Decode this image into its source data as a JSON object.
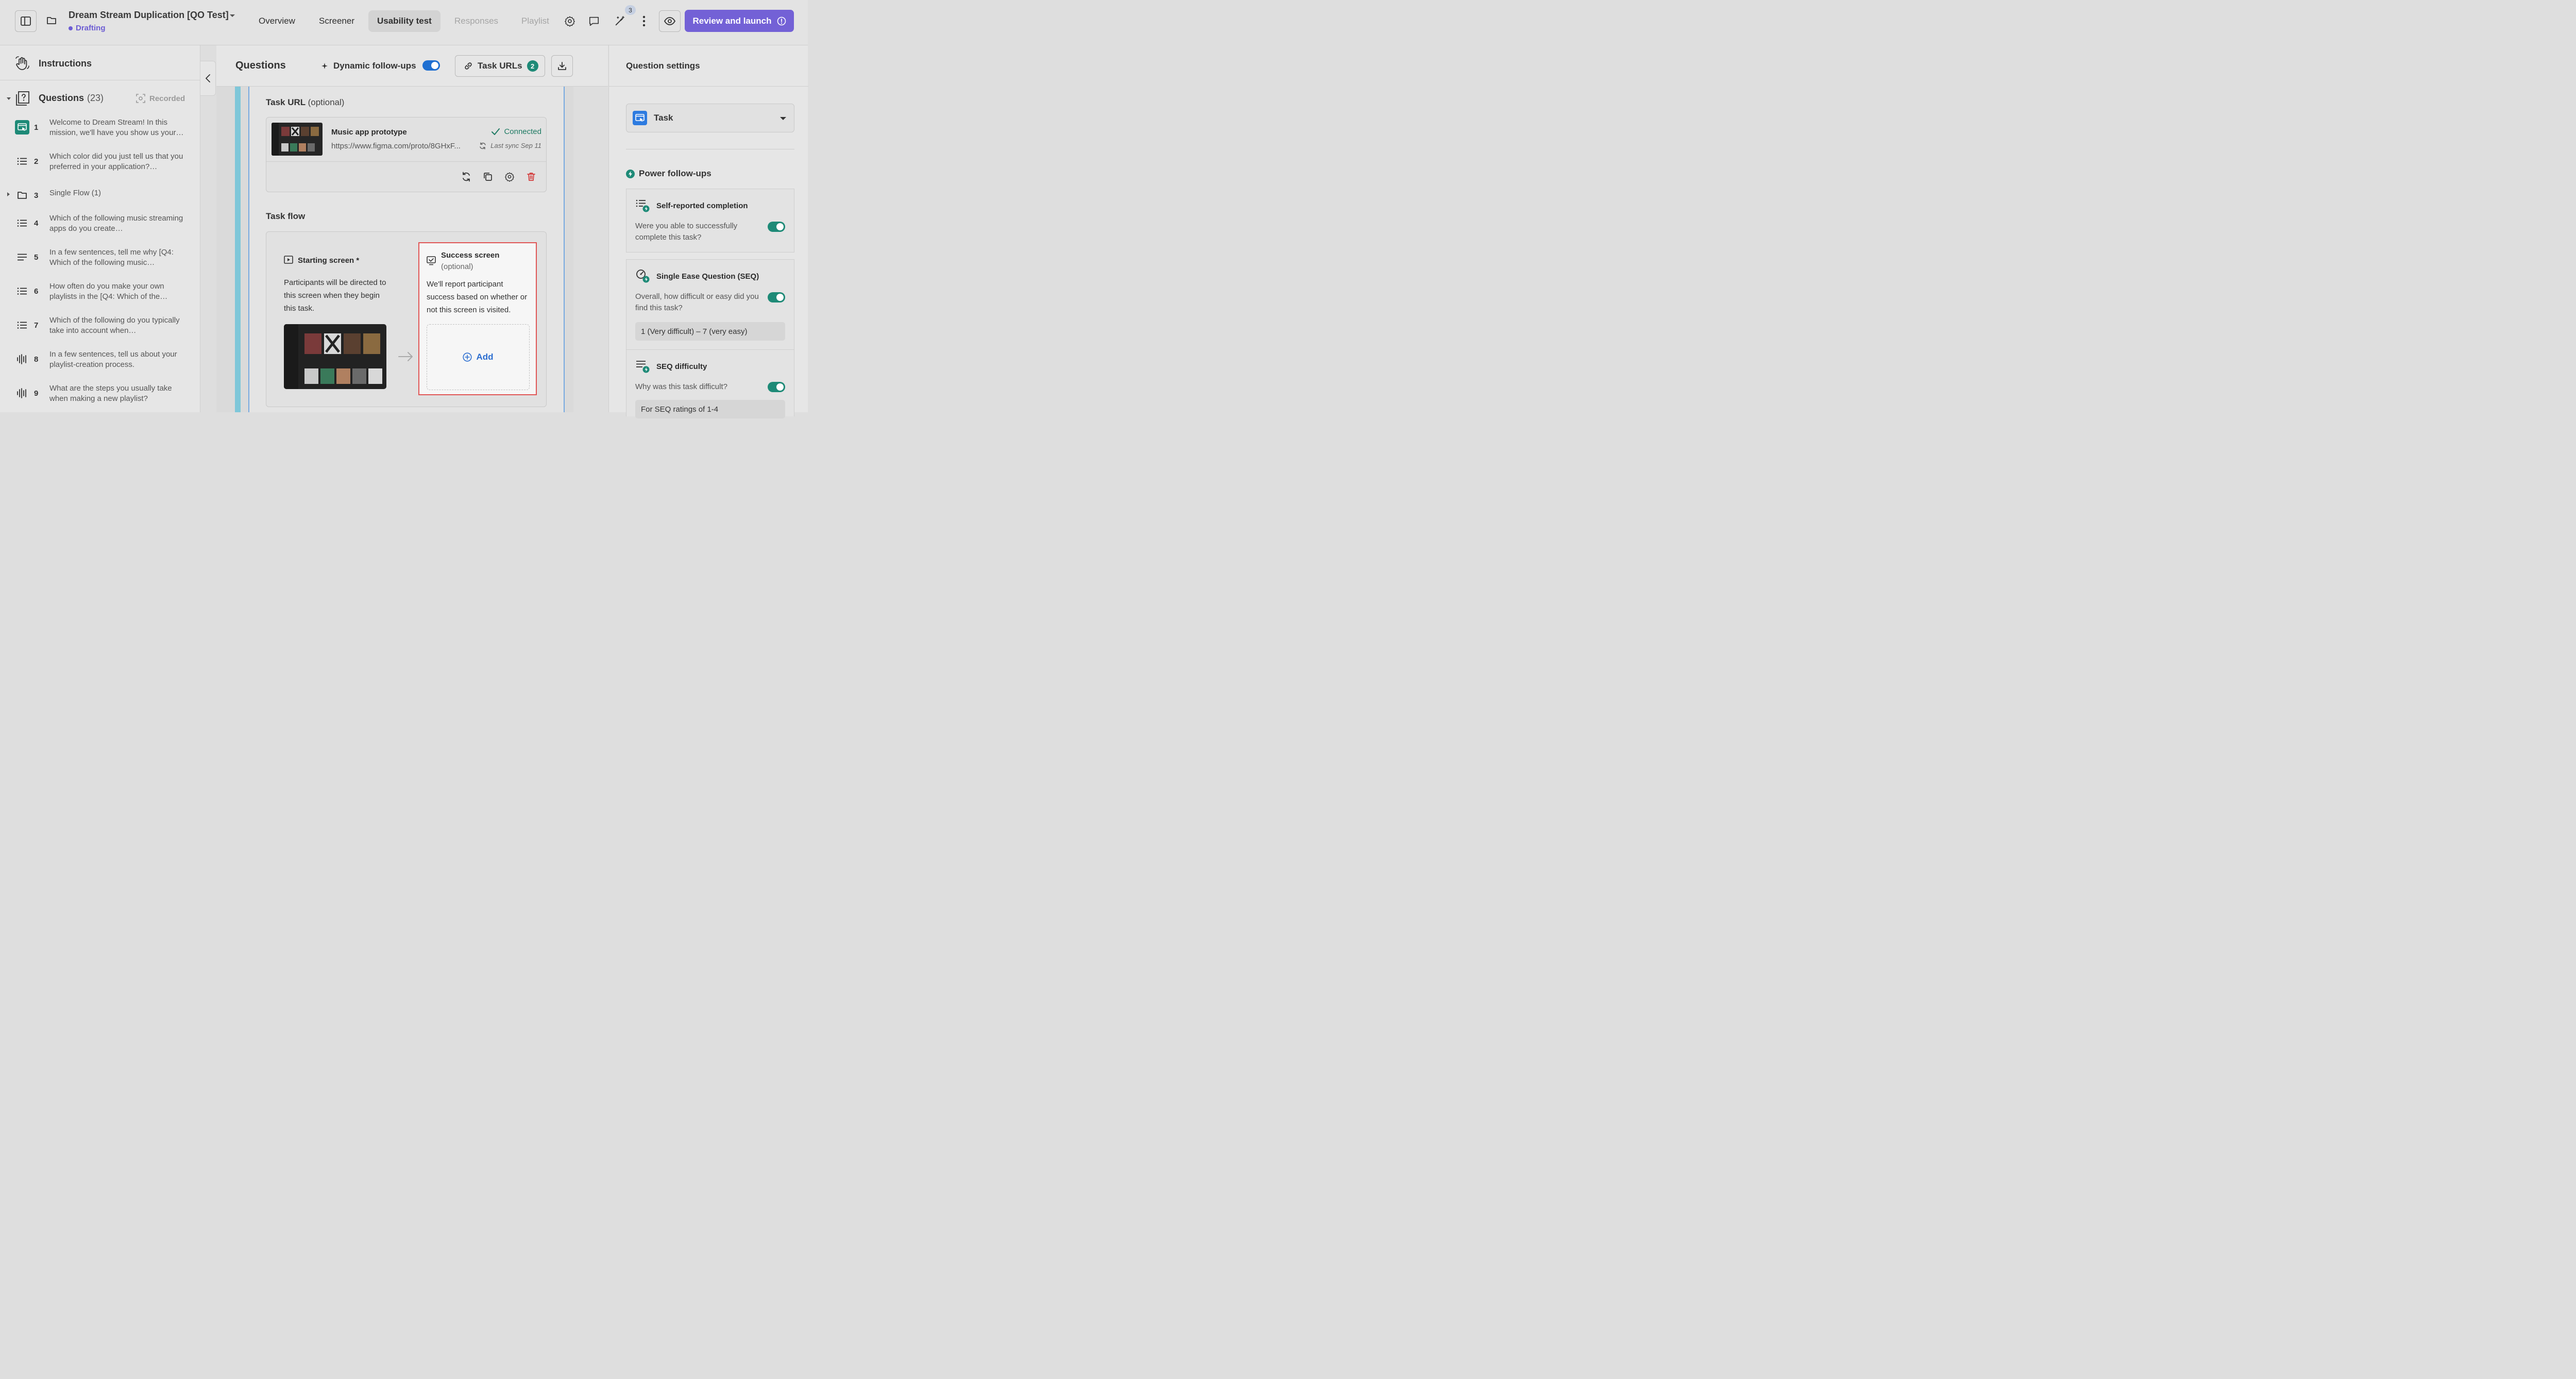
{
  "header": {
    "project_title": "Dream Stream Duplication [QO Test]",
    "status": "Drafting",
    "tabs": [
      {
        "label": "Overview"
      },
      {
        "label": "Screener"
      },
      {
        "label": "Usability test"
      },
      {
        "label": "Responses"
      },
      {
        "label": "Playlist"
      }
    ],
    "notification_count": "3",
    "review_label": "Review and launch"
  },
  "sidebar": {
    "instructions_label": "Instructions",
    "questions_label": "Questions",
    "questions_count": "(23)",
    "recorded_label": "Recorded",
    "items": [
      {
        "num": "1",
        "text": "Welcome to Dream Stream! In this mission, we'll have you show us your…",
        "icon": "task-icon"
      },
      {
        "num": "2",
        "text": "Which color did you just tell us that you preferred in your application?…",
        "icon": "list-icon"
      },
      {
        "num": "3",
        "text": "Single Flow  (1)",
        "icon": "folder-icon"
      },
      {
        "num": "4",
        "text": "Which of the following music streaming apps do you create…",
        "icon": "list-icon"
      },
      {
        "num": "5",
        "text": "In a few sentences, tell me why [Q4: Which of the following music…",
        "icon": "text-icon"
      },
      {
        "num": "6",
        "text": "How often do you make your own playlists in the [Q4: Which of the…",
        "icon": "list-icon"
      },
      {
        "num": "7",
        "text": "Which of the following do you typically take into account when…",
        "icon": "list-icon"
      },
      {
        "num": "8",
        "text": "In a few sentences, tell us about your playlist-creation process.",
        "icon": "audio-icon"
      },
      {
        "num": "9",
        "text": "What are the steps you usually take when making a new playlist?",
        "icon": "audio-icon"
      }
    ]
  },
  "main": {
    "title": "Questions",
    "dynamic_followups_label": "Dynamic follow-ups",
    "task_urls_label": "Task URLs",
    "task_urls_count": "2",
    "task_url_label": "Task URL",
    "optional_label": "(optional)",
    "prototype": {
      "name": "Music app prototype",
      "url": "https://www.figma.com/proto/8GHxF...",
      "status": "Connected",
      "last_sync": "Last sync Sep 11"
    },
    "task_flow_label": "Task flow",
    "starting_screen": {
      "title": "Starting screen *",
      "description": "Participants will be directed to this screen when they begin this task."
    },
    "success_screen": {
      "title": "Success screen",
      "subtitle": "(optional)",
      "description": "We'll report participant success based on whether or not this screen is visited.",
      "add_label": "Add"
    }
  },
  "settings": {
    "title": "Question settings",
    "type_label": "Task",
    "power_followups_label": "Power follow-ups",
    "followups": [
      {
        "title": "Self-reported completion",
        "description": "Were you able to successfully complete this task?",
        "enabled": true
      },
      {
        "title": "Single Ease Question (SEQ)",
        "description": "Overall, how difficult or easy did you find this task?",
        "enabled": true,
        "field": "1 (Very difficult) – 7 (very easy)"
      },
      {
        "title": "SEQ difficulty",
        "description": "Why was this task difficult?",
        "enabled": true,
        "field": "For SEQ ratings of 1-4"
      }
    ]
  },
  "colors": {
    "accent": "#7361d6",
    "teal": "#1e8a77",
    "blue": "#1f6fd1",
    "error": "#e05555"
  }
}
